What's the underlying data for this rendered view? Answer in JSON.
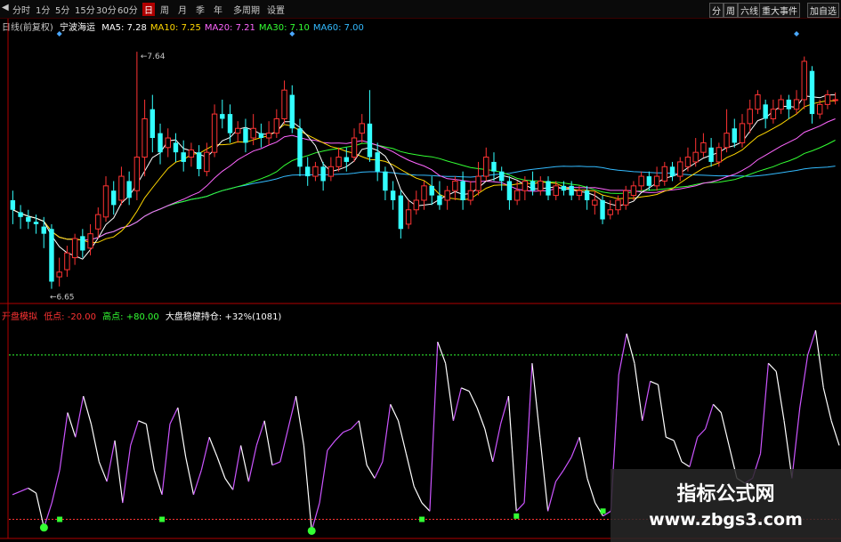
{
  "toolbar": {
    "items": [
      {
        "label": "分时",
        "active": false
      },
      {
        "label": "1分",
        "active": false
      },
      {
        "label": "5分",
        "active": false
      },
      {
        "label": "15分",
        "active": false
      },
      {
        "label": "30分",
        "active": false
      },
      {
        "label": "60分",
        "active": false
      },
      {
        "label": "日",
        "active": true
      },
      {
        "label": "周",
        "active": false
      },
      {
        "label": "月",
        "active": false
      },
      {
        "label": "季",
        "active": false
      },
      {
        "label": "年",
        "active": false
      },
      {
        "label": "多周期",
        "active": false
      },
      {
        "label": "设置",
        "active": false
      }
    ],
    "right_items": [
      "分",
      "周",
      "六线",
      "重大事件",
      "加自选"
    ]
  },
  "main_legend": {
    "prefix": "日线(前复权)",
    "stock_name": "宁波海运",
    "ma": [
      {
        "label": "MA5: 7.28",
        "color": "#ffffff"
      },
      {
        "label": "MA10: 7.25",
        "color": "#ffd700"
      },
      {
        "label": "MA20: 7.21",
        "color": "#ff66ff"
      },
      {
        "label": "MA30: 7.10",
        "color": "#33ff33"
      },
      {
        "label": "MA60: 7.00",
        "color": "#33bbff"
      }
    ],
    "high_label": "7.64",
    "low_label": "6.65"
  },
  "sub_legend": {
    "name": "开盘模拟",
    "low_label": "低点: -20.00",
    "high_label": "高点: +80.00",
    "position_label": "大盘稳健持仓: +32%(1081)"
  },
  "watermark": {
    "title": "指标公式网",
    "url": "www.zbgs3.com"
  },
  "colors": {
    "up": "#ff3333",
    "down": "#33ffff",
    "ma5": "#ffffff",
    "ma10": "#ffd700",
    "ma20": "#ff66ff",
    "ma30": "#33ff33",
    "ma60": "#33bbff",
    "osc_up": "#cc55ff",
    "osc_down": "#ffffff",
    "signal": "#33ff33",
    "grid": "#b00000"
  },
  "chart_data": [
    {
      "type": "candlestick",
      "ylim": [
        6.6,
        7.7
      ],
      "candles": [
        [
          7.02,
          6.98,
          7.06,
          6.92
        ],
        [
          6.97,
          6.95,
          7.0,
          6.9
        ],
        [
          6.95,
          6.93,
          6.98,
          6.9
        ],
        [
          6.93,
          6.92,
          6.96,
          6.88
        ],
        [
          6.91,
          6.88,
          6.95,
          6.82
        ],
        [
          6.9,
          6.68,
          6.92,
          6.65
        ],
        [
          6.7,
          6.72,
          6.78,
          6.66
        ],
        [
          6.73,
          6.8,
          6.83,
          6.7
        ],
        [
          6.78,
          6.86,
          6.88,
          6.75
        ],
        [
          6.87,
          6.81,
          6.9,
          6.78
        ],
        [
          6.82,
          6.88,
          6.92,
          6.79
        ],
        [
          6.9,
          6.96,
          6.99,
          6.86
        ],
        [
          6.95,
          7.08,
          7.12,
          6.93
        ],
        [
          7.06,
          7.0,
          7.1,
          6.96
        ],
        [
          7.02,
          7.12,
          7.16,
          7.0
        ],
        [
          7.1,
          7.03,
          7.14,
          7.0
        ],
        [
          7.06,
          7.2,
          7.64,
          7.02
        ],
        [
          7.2,
          7.36,
          7.44,
          7.12
        ],
        [
          7.4,
          7.28,
          7.46,
          7.22
        ],
        [
          7.3,
          7.22,
          7.34,
          7.17
        ],
        [
          7.24,
          7.28,
          7.32,
          7.2
        ],
        [
          7.26,
          7.22,
          7.3,
          7.18
        ],
        [
          7.22,
          7.18,
          7.27,
          7.14
        ],
        [
          7.2,
          7.23,
          7.26,
          7.16
        ],
        [
          7.22,
          7.15,
          7.25,
          7.12
        ],
        [
          7.14,
          7.22,
          7.26,
          7.12
        ],
        [
          7.22,
          7.38,
          7.42,
          7.2
        ],
        [
          7.38,
          7.36,
          7.44,
          7.32
        ],
        [
          7.38,
          7.3,
          7.42,
          7.26
        ],
        [
          7.3,
          7.32,
          7.35,
          7.26
        ],
        [
          7.32,
          7.26,
          7.36,
          7.22
        ],
        [
          7.28,
          7.32,
          7.38,
          7.25
        ],
        [
          7.3,
          7.28,
          7.34,
          7.24
        ],
        [
          7.28,
          7.3,
          7.35,
          7.25
        ],
        [
          7.3,
          7.36,
          7.4,
          7.28
        ],
        [
          7.36,
          7.48,
          7.52,
          7.34
        ],
        [
          7.46,
          7.32,
          7.5,
          7.3
        ],
        [
          7.32,
          7.16,
          7.36,
          7.12
        ],
        [
          7.16,
          7.12,
          7.2,
          7.08
        ],
        [
          7.12,
          7.16,
          7.18,
          7.1
        ],
        [
          7.16,
          7.1,
          7.18,
          7.06
        ],
        [
          7.12,
          7.16,
          7.2,
          7.1
        ],
        [
          7.16,
          7.2,
          7.24,
          7.14
        ],
        [
          7.2,
          7.18,
          7.24,
          7.14
        ],
        [
          7.2,
          7.28,
          7.32,
          7.18
        ],
        [
          7.3,
          7.34,
          7.38,
          7.26
        ],
        [
          7.34,
          7.2,
          7.48,
          7.18
        ],
        [
          7.22,
          7.14,
          7.26,
          7.1
        ],
        [
          7.14,
          7.06,
          7.16,
          7.02
        ],
        [
          7.06,
          7.02,
          7.1,
          6.98
        ],
        [
          7.04,
          6.9,
          7.06,
          6.86
        ],
        [
          6.92,
          6.98,
          7.02,
          6.9
        ],
        [
          6.98,
          7.02,
          7.06,
          6.96
        ],
        [
          7.02,
          7.08,
          7.1,
          6.98
        ],
        [
          7.08,
          7.04,
          7.12,
          7.0
        ],
        [
          7.04,
          7.0,
          7.1,
          6.98
        ],
        [
          7.02,
          7.06,
          7.08,
          6.98
        ],
        [
          7.06,
          7.1,
          7.12,
          7.02
        ],
        [
          7.1,
          7.02,
          7.14,
          6.98
        ],
        [
          7.02,
          7.06,
          7.1,
          7.0
        ],
        [
          7.06,
          7.12,
          7.18,
          7.04
        ],
        [
          7.12,
          7.2,
          7.24,
          7.1
        ],
        [
          7.18,
          7.14,
          7.22,
          7.1
        ],
        [
          7.14,
          7.1,
          7.16,
          7.06
        ],
        [
          7.1,
          7.02,
          7.12,
          6.98
        ],
        [
          7.02,
          7.06,
          7.1,
          7.0
        ],
        [
          7.06,
          7.1,
          7.12,
          7.02
        ],
        [
          7.1,
          7.06,
          7.14,
          7.04
        ],
        [
          7.06,
          7.1,
          7.12,
          7.04
        ],
        [
          7.1,
          7.04,
          7.12,
          7.02
        ],
        [
          7.04,
          7.08,
          7.1,
          7.02
        ],
        [
          7.08,
          7.06,
          7.1,
          7.04
        ],
        [
          7.08,
          7.04,
          7.1,
          7.02
        ],
        [
          7.04,
          7.06,
          7.08,
          7.02
        ],
        [
          7.06,
          7.02,
          7.08,
          6.98
        ],
        [
          7.0,
          7.02,
          7.06,
          6.96
        ],
        [
          7.02,
          6.94,
          7.04,
          6.92
        ],
        [
          6.96,
          6.98,
          7.02,
          6.94
        ],
        [
          6.98,
          7.02,
          7.04,
          6.96
        ],
        [
          7.0,
          7.06,
          7.08,
          6.98
        ],
        [
          7.04,
          7.08,
          7.1,
          7.02
        ],
        [
          7.08,
          7.12,
          7.14,
          7.06
        ],
        [
          7.12,
          7.08,
          7.14,
          7.06
        ],
        [
          7.08,
          7.12,
          7.16,
          7.06
        ],
        [
          7.1,
          7.16,
          7.18,
          7.08
        ],
        [
          7.16,
          7.12,
          7.18,
          7.1
        ],
        [
          7.12,
          7.18,
          7.2,
          7.1
        ],
        [
          7.16,
          7.2,
          7.24,
          7.14
        ],
        [
          7.18,
          7.22,
          7.28,
          7.16
        ],
        [
          7.22,
          7.26,
          7.3,
          7.2
        ],
        [
          7.24,
          7.18,
          7.28,
          7.16
        ],
        [
          7.18,
          7.24,
          7.26,
          7.16
        ],
        [
          7.24,
          7.3,
          7.4,
          7.22
        ],
        [
          7.32,
          7.26,
          7.36,
          7.24
        ],
        [
          7.26,
          7.34,
          7.38,
          7.24
        ],
        [
          7.34,
          7.4,
          7.44,
          7.3
        ],
        [
          7.4,
          7.46,
          7.48,
          7.38
        ],
        [
          7.42,
          7.36,
          7.44,
          7.32
        ],
        [
          7.36,
          7.4,
          7.44,
          7.34
        ],
        [
          7.4,
          7.44,
          7.46,
          7.38
        ],
        [
          7.44,
          7.4,
          7.46,
          7.36
        ],
        [
          7.4,
          7.44,
          7.48,
          7.38
        ],
        [
          7.44,
          7.6,
          7.62,
          7.4
        ],
        [
          7.56,
          7.38,
          7.58,
          7.34
        ],
        [
          7.38,
          7.42,
          7.44,
          7.36
        ],
        [
          7.42,
          7.46,
          7.48,
          7.4
        ],
        [
          7.44,
          7.44,
          7.47,
          7.42
        ]
      ],
      "ma_series": [
        "ma5",
        "ma10",
        "ma20",
        "ma30",
        "ma60"
      ],
      "high_value": 7.64,
      "low_value": 6.65
    },
    {
      "type": "line",
      "ylim": [
        -30,
        100
      ],
      "reference_lines": [
        -20,
        80
      ],
      "values": [
        -5,
        -3,
        -1,
        -4,
        -25,
        -10,
        10,
        45,
        30,
        55,
        38,
        15,
        3,
        28,
        -10,
        25,
        40,
        38,
        10,
        -5,
        38,
        48,
        18,
        -5,
        10,
        30,
        18,
        5,
        -2,
        25,
        3,
        25,
        40,
        13,
        15,
        35,
        55,
        25,
        -27,
        -10,
        22,
        28,
        33,
        35,
        40,
        13,
        5,
        15,
        50,
        40,
        20,
        0,
        -10,
        -15,
        88,
        75,
        40,
        60,
        58,
        48,
        35,
        15,
        38,
        55,
        -15,
        -10,
        75,
        30,
        -15,
        3,
        10,
        18,
        30,
        5,
        -10,
        -18,
        -15,
        68,
        93,
        75,
        40,
        64,
        62,
        30,
        28,
        15,
        12,
        30,
        35,
        50,
        45,
        25,
        5,
        2,
        5,
        20,
        75,
        70,
        40,
        5,
        48,
        80,
        95,
        60,
        40,
        25
      ],
      "signal_markers": [
        {
          "index": 4,
          "value": -25,
          "size": "large"
        },
        {
          "index": 6,
          "value": -20,
          "size": "small"
        },
        {
          "index": 19,
          "value": -20,
          "size": "small"
        },
        {
          "index": 38,
          "value": -27,
          "size": "large"
        },
        {
          "index": 52,
          "value": -20,
          "size": "small"
        },
        {
          "index": 64,
          "value": -18,
          "size": "small"
        },
        {
          "index": 75,
          "value": -15,
          "size": "small"
        }
      ]
    }
  ]
}
